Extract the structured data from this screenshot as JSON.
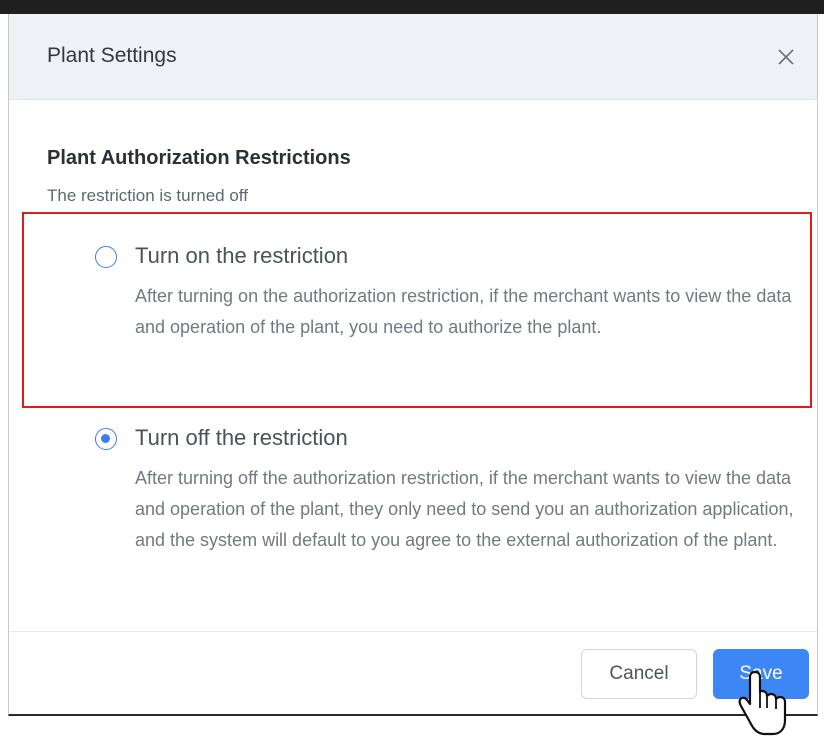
{
  "dialog": {
    "title": "Plant Settings",
    "close_icon": "close-icon"
  },
  "section": {
    "title": "Plant Authorization Restrictions",
    "status": "The restriction is turned off"
  },
  "options": [
    {
      "label": "Turn on the restriction",
      "description": "After turning on the authorization restriction, if the merchant wants to view the data and operation of the plant, you need to authorize the plant.",
      "selected": false
    },
    {
      "label": "Turn off the restriction",
      "description": "After turning off the authorization restriction, if the merchant wants to view the data and operation of the plant, they only need to send you an authorization application, and the system will default to you agree to the external authorization of the plant.",
      "selected": true
    }
  ],
  "footer": {
    "cancel_label": "Cancel",
    "save_label": "Save"
  },
  "colors": {
    "accent": "#3d86f5",
    "highlight": "#e01b1b",
    "header_bg": "#eef1f5"
  },
  "cursor_icon": "hand-pointer-icon"
}
